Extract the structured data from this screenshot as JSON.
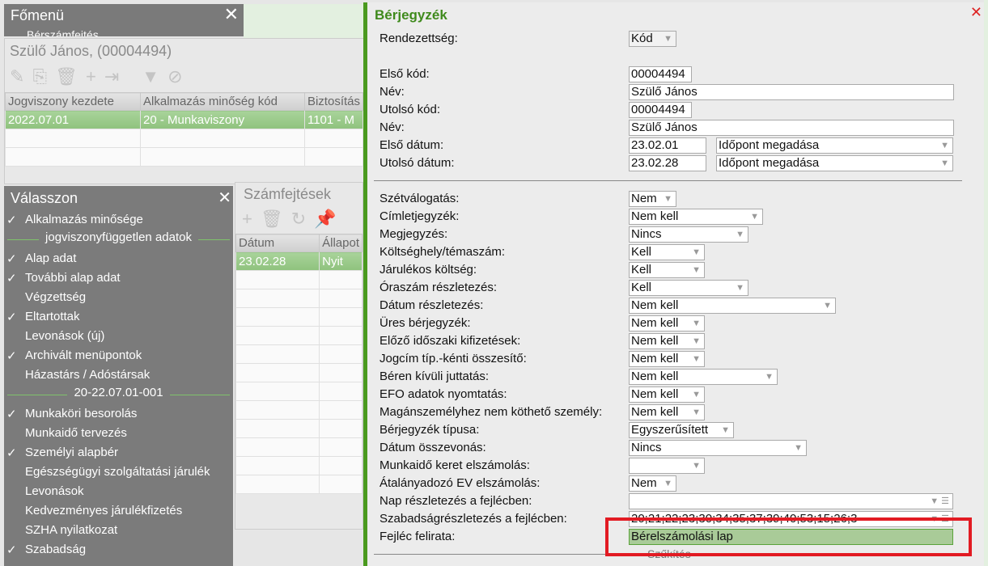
{
  "fomenu": {
    "title": "Főmenü",
    "submenu": "Bérszámfejtés"
  },
  "employee": {
    "title": "Szülő János, (00004494)",
    "columns": [
      "Jogviszony kezdete",
      "Alkalmazás minőség kód",
      "Biztosítás"
    ],
    "rows": [
      [
        "2022.07.01",
        "20 - Munkaviszony",
        "1101 - M"
      ]
    ]
  },
  "valasszon": {
    "title": "Válasszon",
    "items": [
      {
        "label": "Alkalmazás minősége",
        "checked": true
      },
      {
        "label": "jogviszonyfüggetlen adatok",
        "separator": true
      },
      {
        "label": "Alap adat",
        "checked": true
      },
      {
        "label": "További alap adat",
        "checked": true
      },
      {
        "label": "Végzettség",
        "checked": false
      },
      {
        "label": "Eltartottak",
        "checked": true
      },
      {
        "label": "Levonások (új)",
        "checked": false
      },
      {
        "label": "Archivált menüpontok",
        "checked": true
      },
      {
        "label": "Házastárs / Adóstársak",
        "checked": false
      },
      {
        "label": "20-22.07.01-001",
        "separator": true
      },
      {
        "label": "Munkaköri besorolás",
        "checked": true
      },
      {
        "label": "Munkaidő tervezés",
        "checked": false
      },
      {
        "label": "Személyi alapbér",
        "checked": true
      },
      {
        "label": "Egészségügyi szolgáltatási járulék",
        "checked": false
      },
      {
        "label": "Levonások",
        "checked": false
      },
      {
        "label": "Kedvezményes járulékfizetés",
        "checked": false
      },
      {
        "label": "SZHA nyilatkozat",
        "checked": false
      },
      {
        "label": "Szabadság",
        "checked": true
      }
    ]
  },
  "szamfejtesek": {
    "title": "Számfejtések",
    "columns": [
      "Dátum",
      "Állapot"
    ],
    "rows": [
      [
        "23.02.28",
        "Nyit"
      ]
    ]
  },
  "dialog": {
    "title": "Bérjegyzék",
    "top": [
      {
        "label": "Rendezettség:",
        "value": "Kód",
        "type": "select"
      },
      {
        "label": "Első kód:",
        "value": "00004494",
        "type": "text"
      },
      {
        "label": "Név:",
        "value": "Szülő János",
        "type": "text"
      },
      {
        "label": "Utolsó kód:",
        "value": "00004494",
        "type": "text"
      },
      {
        "label": "Név:",
        "value": "Szülő János",
        "type": "text"
      },
      {
        "label": "Első dátum:",
        "value": "23.02.01",
        "type": "date",
        "extra": "Időpont megadása"
      },
      {
        "label": "Utolsó dátum:",
        "value": "23.02.28",
        "type": "date",
        "extra": "Időpont megadása"
      }
    ],
    "options": [
      {
        "label": "Szétválogatás:",
        "value": "Nem"
      },
      {
        "label": "Címletjegyzék:",
        "value": "Nem kell"
      },
      {
        "label": "Megjegyzés:",
        "value": "Nincs"
      },
      {
        "label": "Költséghely/témaszám:",
        "value": "Kell"
      },
      {
        "label": "Járulékos költség:",
        "value": "Kell"
      },
      {
        "label": "Óraszám részletezés:",
        "value": "Kell"
      },
      {
        "label": "Dátum részletezés:",
        "value": "Nem kell"
      },
      {
        "label": "Üres bérjegyzék:",
        "value": "Nem kell"
      },
      {
        "label": "Előző időszaki kifizetések:",
        "value": "Nem kell"
      },
      {
        "label": "Jogcím típ.-kénti összesítő:",
        "value": "Nem kell"
      },
      {
        "label": "Béren kívüli juttatás:",
        "value": "Nem kell"
      },
      {
        "label": "EFO adatok nyomtatás:",
        "value": "Nem kell"
      },
      {
        "label": "Magánszemélyhez nem köthető személy:",
        "value": "Nem kell"
      },
      {
        "label": "Bérjegyzék típusa:",
        "value": "Egyszerűsített"
      },
      {
        "label": "Dátum összevonás:",
        "value": "Nincs"
      },
      {
        "label": "Munkaidő keret elszámolás:",
        "value": ""
      },
      {
        "label": "Átalányadozó EV elszámolás:",
        "value": "Nem"
      },
      {
        "label": "Nap részletezés a fejlécben:",
        "value": ""
      },
      {
        "label": "Szabadságrészletezés a fejlécben:",
        "value": "20;21;22;23;30;34;35;37;39;40;53;15;26;3"
      },
      {
        "label": "Fejléc felirata:",
        "value": "Bérelszámolási lap"
      }
    ],
    "section": "Szűkítés"
  },
  "colors": {
    "accent": "#4a9a1f",
    "highlight": "#e21b23",
    "selected_row": "#9bcb8a"
  }
}
